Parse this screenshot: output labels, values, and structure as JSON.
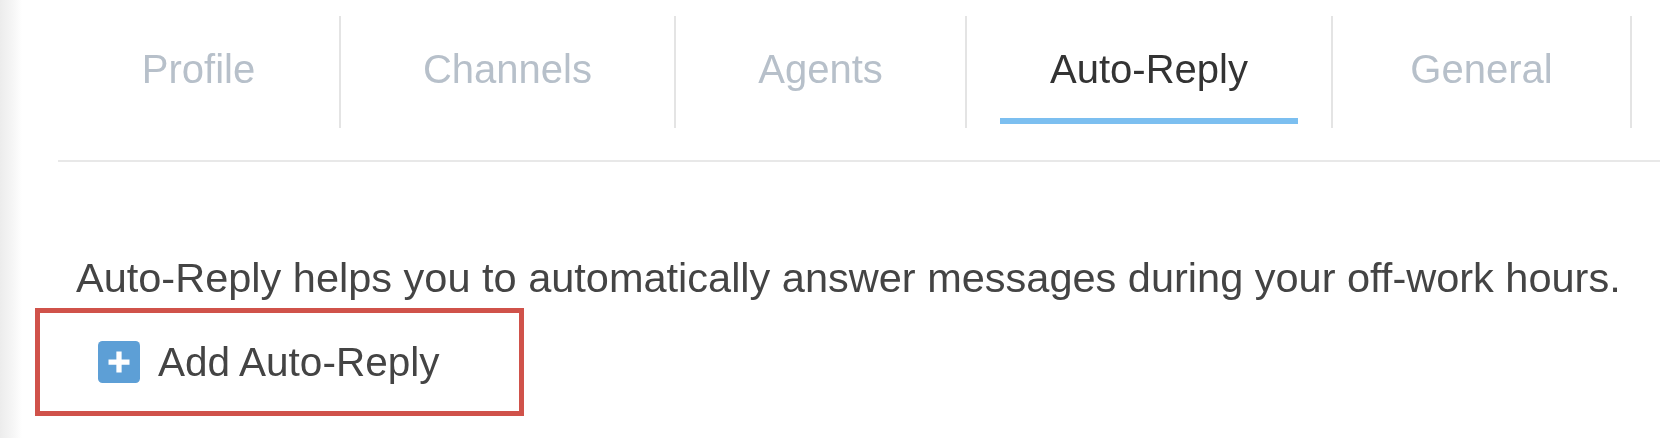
{
  "tabs": [
    {
      "label": "Profile",
      "selected": false
    },
    {
      "label": "Channels",
      "selected": false
    },
    {
      "label": "Agents",
      "selected": false
    },
    {
      "label": "Auto-Reply",
      "selected": true
    },
    {
      "label": "General",
      "selected": false
    }
  ],
  "description": "Auto-Reply helps you to automatically answer messages during your off-work hours.",
  "add_button": {
    "label": "Add Auto-Reply",
    "highlighted": true
  }
}
